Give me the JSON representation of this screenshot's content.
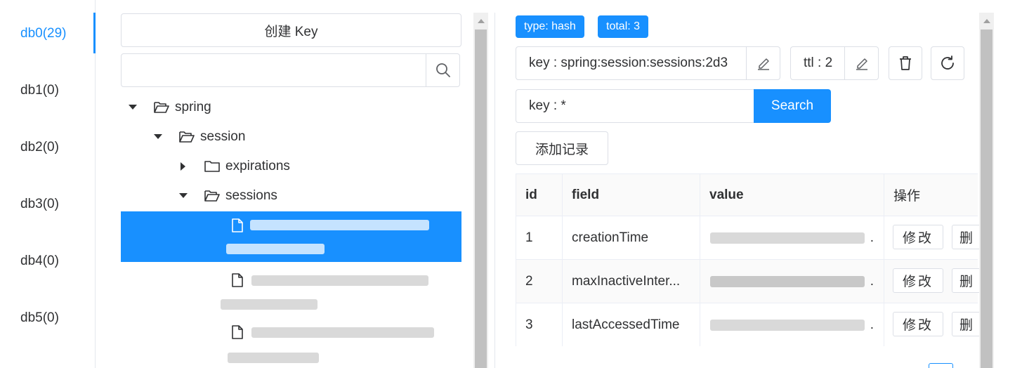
{
  "databases": [
    {
      "label": "db0(29)",
      "active": true
    },
    {
      "label": "db1(0)",
      "active": false
    },
    {
      "label": "db2(0)",
      "active": false
    },
    {
      "label": "db3(0)",
      "active": false
    },
    {
      "label": "db4(0)",
      "active": false
    },
    {
      "label": "db5(0)",
      "active": false
    }
  ],
  "key_panel": {
    "create_label": "创建 Key",
    "search_placeholder": "",
    "tree": [
      {
        "label": "spring",
        "expanded": true,
        "type": "folder-open"
      },
      {
        "label": "session",
        "expanded": true,
        "type": "folder-open"
      },
      {
        "label": "expirations",
        "expanded": false,
        "type": "folder"
      },
      {
        "label": "sessions",
        "expanded": true,
        "type": "folder-open"
      }
    ]
  },
  "detail": {
    "tags": {
      "type": "type: hash",
      "total": "total: 3"
    },
    "key_field": "key : spring:session:sessions:2d3",
    "ttl_field": "ttl : 2",
    "field_search": "key : *",
    "search_label": "Search",
    "add_label": "添加记录",
    "table": {
      "headers": [
        "id",
        "field",
        "value",
        "操作"
      ],
      "rows": [
        {
          "id": "1",
          "field": "creationTime",
          "value": "."
        },
        {
          "id": "2",
          "field": "maxInactiveInter...",
          "value": "."
        },
        {
          "id": "3",
          "field": "lastAccessedTime",
          "value": "."
        }
      ],
      "edit_label": "修改",
      "delete_label": "删"
    }
  },
  "colors": {
    "accent": "#1890ff",
    "border": "#dcdfe6"
  }
}
